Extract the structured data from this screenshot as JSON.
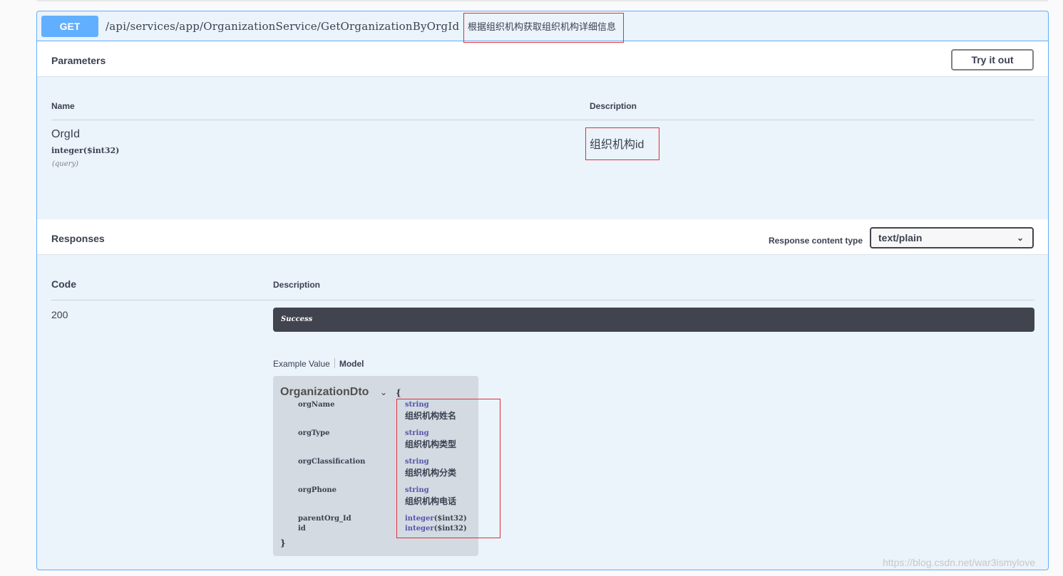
{
  "endpoint": {
    "method": "GET",
    "path": "/api/services/app/OrganizationService/GetOrganizationByOrgId",
    "summary": "根据组织机构获取组织机构详细信息"
  },
  "parameters": {
    "title": "Parameters",
    "try_label": "Try it out",
    "col_name": "Name",
    "col_description": "Description",
    "items": [
      {
        "name": "OrgId",
        "type": "integer($int32)",
        "in": "(query)",
        "description": "组织机构id"
      }
    ]
  },
  "responses": {
    "title": "Responses",
    "content_type_label": "Response content type",
    "content_type_value": "text/plain",
    "col_code": "Code",
    "col_description": "Description",
    "rows": [
      {
        "code": "200",
        "description": "Success"
      }
    ],
    "tab_example": "Example Value",
    "tab_model": "Model",
    "model": {
      "name": "OrganizationDto",
      "open_brace": "{",
      "close_brace": "}",
      "props": [
        {
          "name": "orgName",
          "type": "string",
          "description": "组织机构姓名"
        },
        {
          "name": "orgType",
          "type": "string",
          "description": "组织机构类型"
        },
        {
          "name": "orgClassification",
          "type": "string",
          "description": "组织机构分类"
        },
        {
          "name": "orgPhone",
          "type": "string",
          "description": "组织机构电话"
        },
        {
          "name": "parentOrg_Id",
          "type": "integer",
          "format": "($int32)"
        },
        {
          "name": "id",
          "type": "integer",
          "format": "($int32)"
        }
      ]
    }
  },
  "watermark": "https://blog.csdn.net/war3ismylove",
  "colors": {
    "get_blue": "#61affe",
    "annotation_red": "#e0303a",
    "dark_bar": "#41444e"
  }
}
